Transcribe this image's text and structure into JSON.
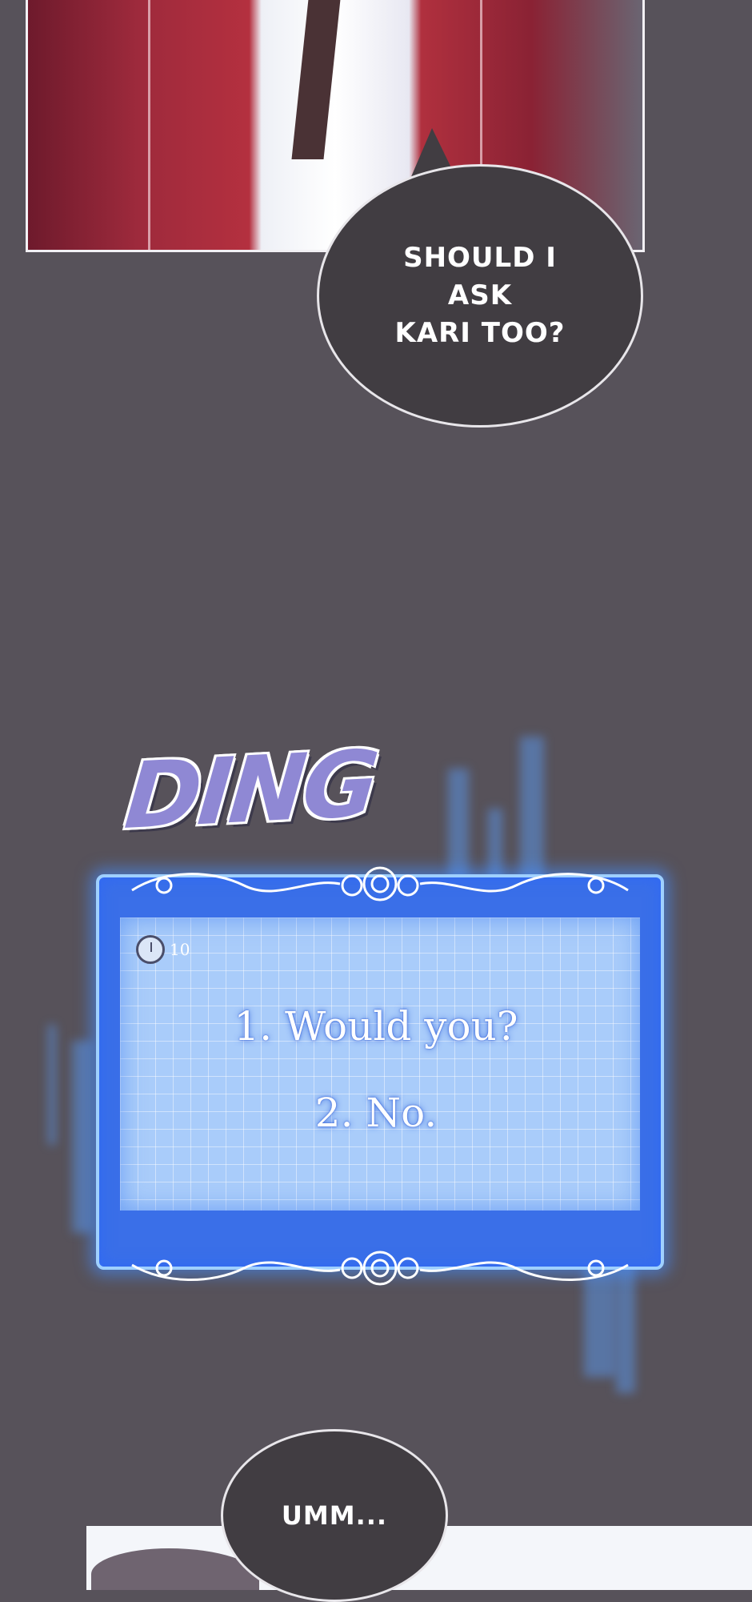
{
  "bubble_top": {
    "text_line1": "SHOULD I ASK",
    "text_line2": "KARI TOO?"
  },
  "sound_effect": "DING",
  "choice_window": {
    "timer": "10",
    "choices": [
      "1. Would you?",
      "2. No."
    ]
  },
  "bubble_bottom": {
    "text": "UMM..."
  },
  "colors": {
    "background": "#57525a",
    "bubble": "#413d42",
    "window_glow": "#3a6fe8",
    "sfx": "#8f88d4"
  }
}
